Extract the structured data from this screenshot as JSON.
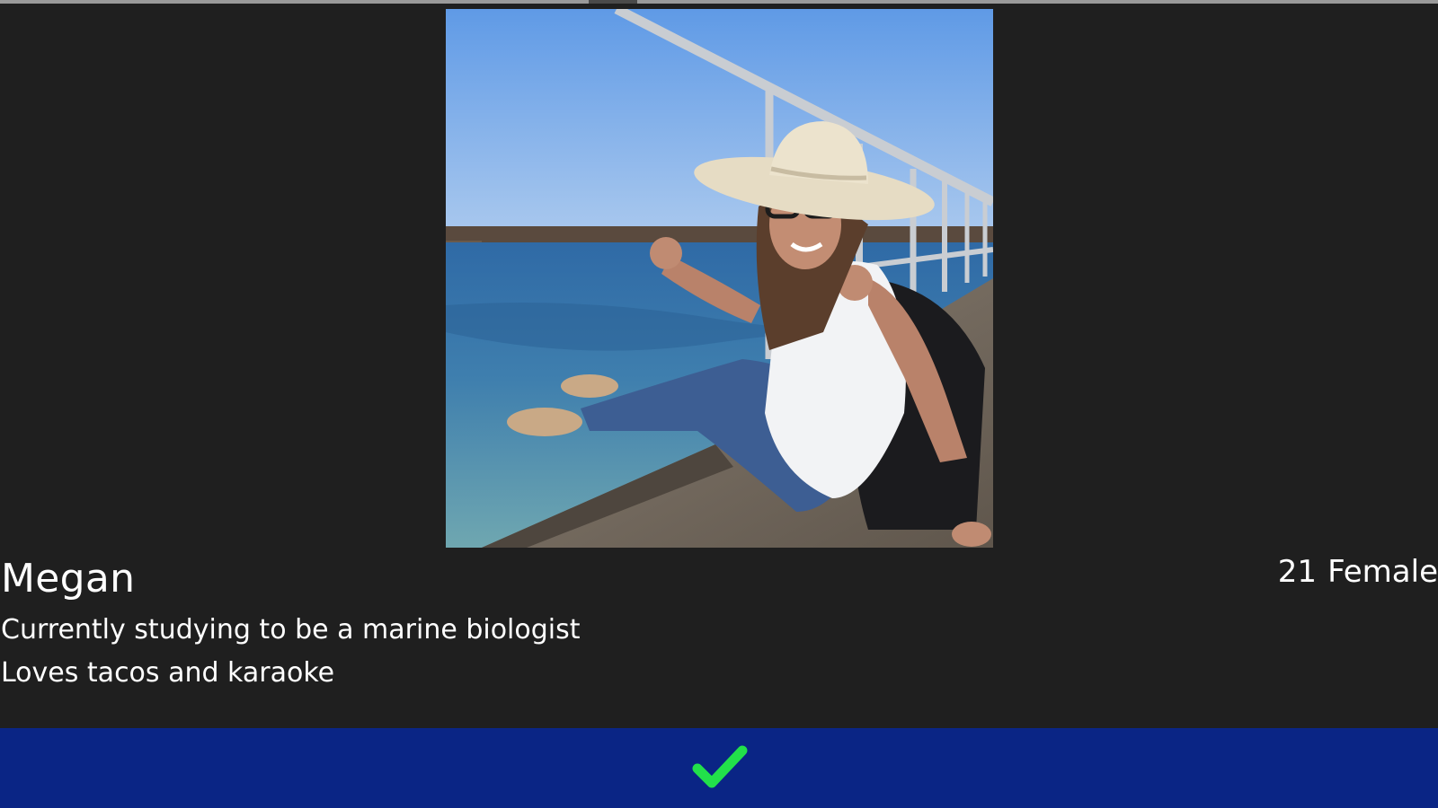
{
  "profile": {
    "name": "Megan",
    "age": "21",
    "gender": "Female",
    "bio": [
      "Currently studying to be a marine biologist",
      "Loves tacos and karaoke"
    ]
  },
  "photo": {
    "subject": "woman in wide-brim sun hat and glasses sitting on a pier by the sea"
  },
  "actions": {
    "accept_icon": "checkmark-icon",
    "accept_color": "#22e04a"
  },
  "colors": {
    "background": "#1f1f1f",
    "action_bar": "#0a2585",
    "text": "#ffffff"
  }
}
